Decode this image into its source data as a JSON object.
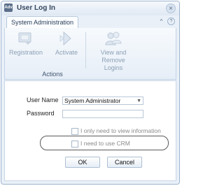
{
  "window": {
    "title": "User Log In",
    "app_icon_text": "Adv",
    "close_glyph": "×"
  },
  "tabs": [
    {
      "label": "System Administration",
      "active": true
    }
  ],
  "tab_controls": {
    "collapse_glyph": "^",
    "help_glyph": "?"
  },
  "ribbon": {
    "buttons": [
      {
        "label_line1": "Registration",
        "label_line2": "",
        "icon": "registration-icon",
        "enabled": false
      },
      {
        "label_line1": "Activate",
        "label_line2": "",
        "icon": "activate-icon",
        "enabled": false
      },
      {
        "label_line1": "View and",
        "label_line2": "Remove Logins",
        "icon": "users-icon",
        "enabled": false
      }
    ],
    "group_label": "Actions"
  },
  "form": {
    "user_name_label": "User Name",
    "user_name_value": "System Administrator",
    "password_label": "Password",
    "password_value": "",
    "checkbox_view_info": {
      "label": "I only need to view information",
      "checked": false
    },
    "checkbox_crm": {
      "label": "I need to use CRM",
      "checked": false
    },
    "ok_label": "OK",
    "cancel_label": "Cancel"
  },
  "colors": {
    "window_bg": "#e9f0f8",
    "title_text": "#34475e",
    "disabled_text": "#8da0b6",
    "highlight_ring": "#5a5a5a"
  }
}
